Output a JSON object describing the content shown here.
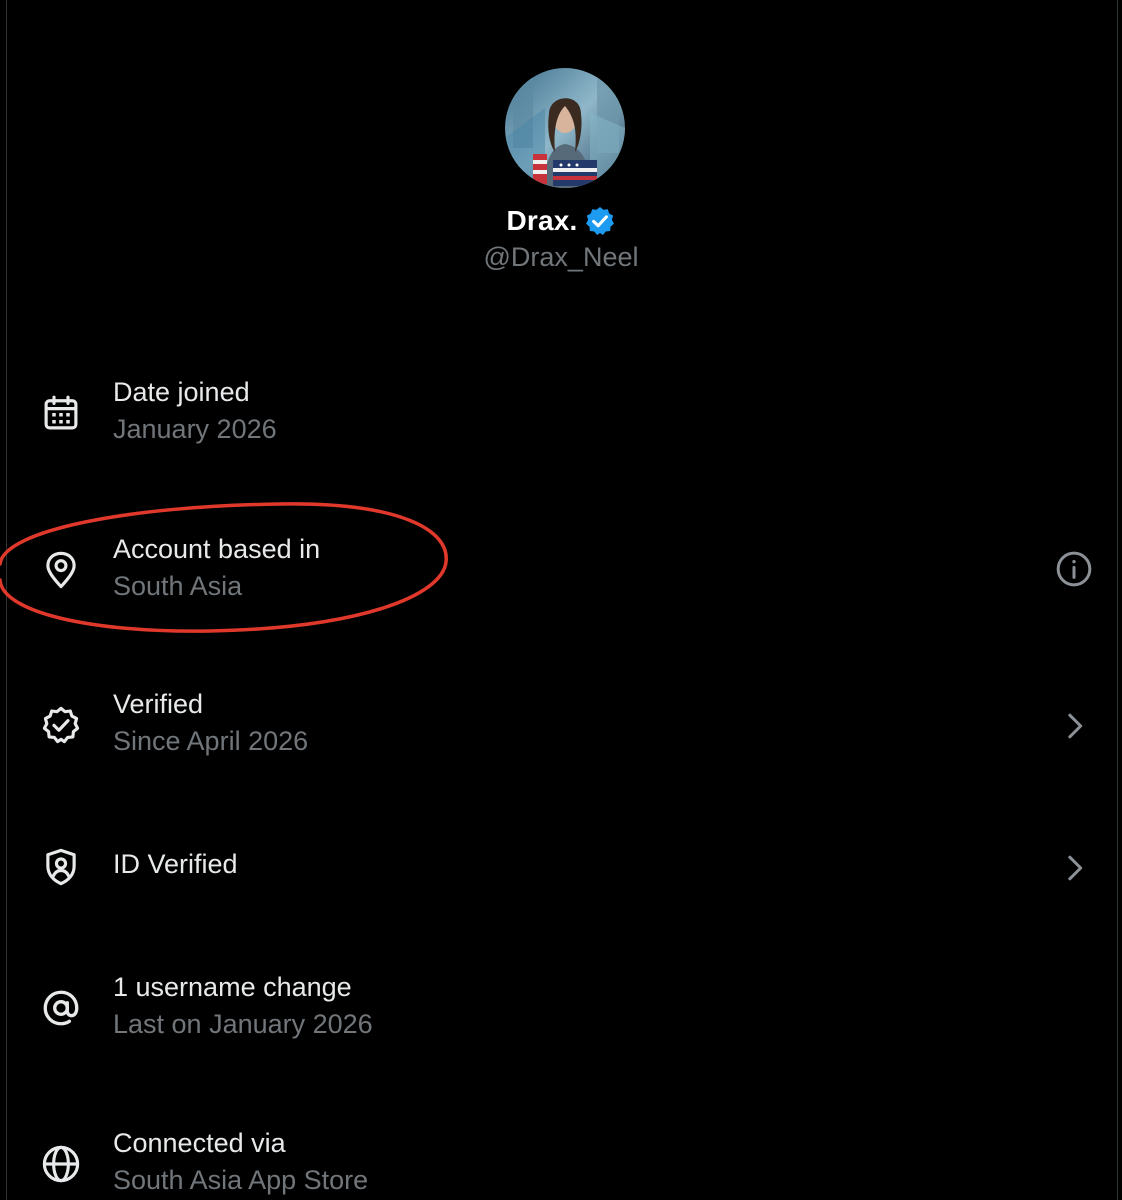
{
  "profile": {
    "display_name": "Drax.",
    "handle": "@Drax_Neel",
    "avatar_icon": "profile-photo",
    "verified_badge_icon": "verified-badge-icon",
    "badge_color": "#1d9bf0"
  },
  "details": [
    {
      "id": "date-joined",
      "icon": "calendar-icon",
      "title": "Date joined",
      "subtitle": "January 2026",
      "trailing": ""
    },
    {
      "id": "account-based-in",
      "icon": "location-pin-icon",
      "title": "Account based in",
      "subtitle": "South Asia",
      "trailing": "info-icon"
    },
    {
      "id": "verified",
      "icon": "verified-outline-icon",
      "title": "Verified",
      "subtitle": "Since April 2026",
      "trailing": "chevron-right-icon"
    },
    {
      "id": "id-verified",
      "icon": "shield-person-icon",
      "title": "ID Verified",
      "subtitle": "",
      "trailing": "chevron-right-icon"
    },
    {
      "id": "username-change",
      "icon": "at-sign-icon",
      "title": "1 username change",
      "subtitle": "Last on January 2026",
      "trailing": ""
    },
    {
      "id": "connected-via",
      "icon": "globe-icon",
      "title": "Connected via",
      "subtitle": "South Asia App Store",
      "trailing": ""
    }
  ],
  "annotation": {
    "shape": "ellipse",
    "color": "#e0392b",
    "highlights": "account-based-in"
  },
  "colors": {
    "background": "#000000",
    "primary_text": "#e7e9ea",
    "secondary_text": "#71767b"
  }
}
